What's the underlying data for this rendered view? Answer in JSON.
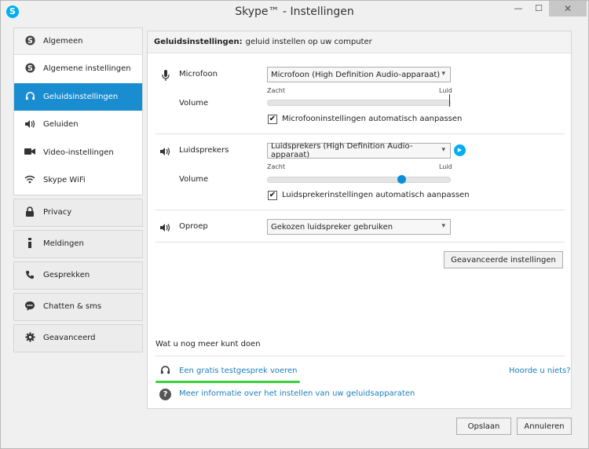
{
  "window": {
    "title": "Skype™ - Instellingen",
    "minimize": "—",
    "maximize": "☐",
    "close": "✕",
    "app_icon": "S"
  },
  "sidebar": {
    "group_header": {
      "label": "Algemeen",
      "icon": "skype-icon"
    },
    "items": [
      {
        "label": "Algemene instellingen",
        "icon": "skype-icon"
      },
      {
        "label": "Geluidsinstellingen",
        "icon": "headset-icon"
      },
      {
        "label": "Geluiden",
        "icon": "speaker-icon"
      },
      {
        "label": "Video-instellingen",
        "icon": "camera-icon"
      },
      {
        "label": "Skype WiFi",
        "icon": "wifi-icon"
      }
    ],
    "categories": [
      {
        "label": "Privacy",
        "icon": "lock-icon"
      },
      {
        "label": "Meldingen",
        "icon": "info-icon"
      },
      {
        "label": "Gesprekken",
        "icon": "phone-icon"
      },
      {
        "label": "Chatten & sms",
        "icon": "chat-icon"
      },
      {
        "label": "Geavanceerd",
        "icon": "gear-icon"
      }
    ]
  },
  "panel": {
    "header_bold": "Geluidsinstellingen:",
    "header_text": "geluid instellen op uw computer",
    "microphone": {
      "label": "Microfoon",
      "selected": "Microfoon (High Definition Audio-apparaat)",
      "volume_label": "Volume",
      "min_label": "Zacht",
      "max_label": "Luid",
      "level": 1.0,
      "auto_label": "Microfooninstellingen automatisch aanpassen",
      "auto_checked": true
    },
    "speakers": {
      "label": "Luidsprekers",
      "selected": "Luidsprekers (High Definition Audio-apparaat)",
      "volume_label": "Volume",
      "min_label": "Zacht",
      "max_label": "Luid",
      "level": 0.73,
      "auto_label": "Luidsprekerinstellingen automatisch aanpassen",
      "auto_checked": true
    },
    "ringing": {
      "label": "Oproep",
      "selected": "Gekozen luidspreker gebruiken"
    },
    "advanced_button": "Geavanceerde instellingen",
    "more_title": "Wat u nog meer kunt doen",
    "test_call_link": "Een gratis testgesprek voeren",
    "hear_link": "Hoorde u niets?",
    "more_info_link": "Meer informatie over het instellen van uw geluidsapparaten"
  },
  "footer": {
    "save": "Opslaan",
    "cancel": "Annuleren"
  },
  "colors": {
    "accent": "#1a8dd1",
    "skype_blue": "#00aff0",
    "link": "#1a7fbf",
    "highlight_green": "#39d43a"
  }
}
